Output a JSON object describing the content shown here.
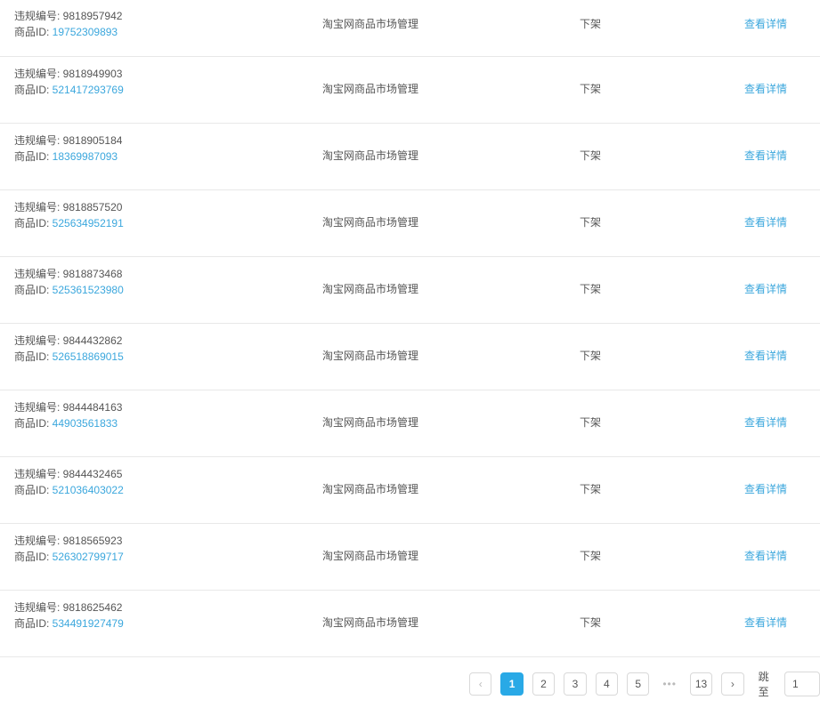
{
  "rows": [
    {
      "violation_label": "违规编号: ",
      "violation_no": "9818957942",
      "id_label": "商品ID: ",
      "product_id": "19752309893",
      "category": "淘宝网商品市场管理",
      "action": "下架",
      "link": "查看详情"
    },
    {
      "violation_label": "违规编号: ",
      "violation_no": "9818949903",
      "id_label": "商品ID: ",
      "product_id": "521417293769",
      "category": "淘宝网商品市场管理",
      "action": "下架",
      "link": "查看详情"
    },
    {
      "violation_label": "违规编号: ",
      "violation_no": "9818905184",
      "id_label": "商品ID: ",
      "product_id": "18369987093",
      "category": "淘宝网商品市场管理",
      "action": "下架",
      "link": "查看详情"
    },
    {
      "violation_label": "违规编号: ",
      "violation_no": "9818857520",
      "id_label": "商品ID: ",
      "product_id": "525634952191",
      "category": "淘宝网商品市场管理",
      "action": "下架",
      "link": "查看详情"
    },
    {
      "violation_label": "违规编号: ",
      "violation_no": "9818873468",
      "id_label": "商品ID: ",
      "product_id": "525361523980",
      "category": "淘宝网商品市场管理",
      "action": "下架",
      "link": "查看详情"
    },
    {
      "violation_label": "违规编号: ",
      "violation_no": "9844432862",
      "id_label": "商品ID: ",
      "product_id": "526518869015",
      "category": "淘宝网商品市场管理",
      "action": "下架",
      "link": "查看详情"
    },
    {
      "violation_label": "违规编号: ",
      "violation_no": "9844484163",
      "id_label": "商品ID: ",
      "product_id": "44903561833",
      "category": "淘宝网商品市场管理",
      "action": "下架",
      "link": "查看详情"
    },
    {
      "violation_label": "违规编号: ",
      "violation_no": "9844432465",
      "id_label": "商品ID: ",
      "product_id": "521036403022",
      "category": "淘宝网商品市场管理",
      "action": "下架",
      "link": "查看详情"
    },
    {
      "violation_label": "违规编号: ",
      "violation_no": "9818565923",
      "id_label": "商品ID: ",
      "product_id": "526302799717",
      "category": "淘宝网商品市场管理",
      "action": "下架",
      "link": "查看详情"
    },
    {
      "violation_label": "违规编号: ",
      "violation_no": "9818625462",
      "id_label": "商品ID: ",
      "product_id": "534491927479",
      "category": "淘宝网商品市场管理",
      "action": "下架",
      "link": "查看详情"
    }
  ],
  "pagination": {
    "prev_icon": "‹",
    "next_icon": "›",
    "pages": [
      "1",
      "2",
      "3",
      "4",
      "5"
    ],
    "current": "1",
    "ellipsis": "•••",
    "last": "13",
    "jump_label": "跳至",
    "jump_value": "1"
  },
  "colors": {
    "accent": "#29a9e6",
    "link": "#3ba7dd"
  }
}
